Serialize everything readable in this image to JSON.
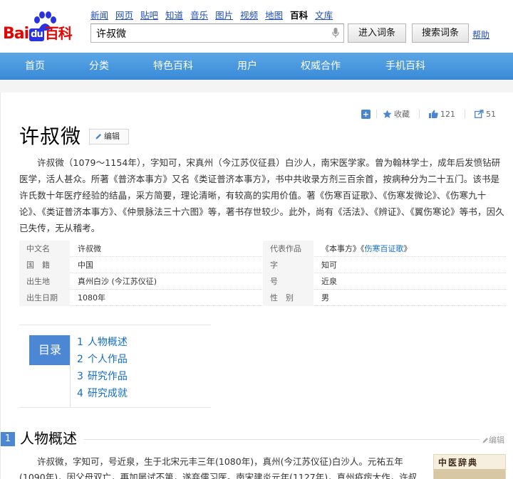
{
  "header": {
    "logo_text": "Bai du 百科",
    "logo_bai": "Bai",
    "logo_du": "du",
    "logo_baike": "百科",
    "top_nav": [
      "新闻",
      "网页",
      "贴吧",
      "知道",
      "音乐",
      "图片",
      "视频",
      "地图",
      "百科",
      "文库"
    ],
    "top_nav_current": "百科",
    "search_value": "许叔微",
    "enter_button": "进入词条",
    "search_button": "搜索词条",
    "help_link": "帮助"
  },
  "main_nav": [
    "首页",
    "分类",
    "特色百科",
    "用户",
    "权威合作",
    "手机百科"
  ],
  "toolbar": {
    "collect_label": "收藏",
    "like_count": "121",
    "share_count": "51"
  },
  "entry": {
    "title": "许叔微",
    "edit_label": "编辑",
    "summary": "许叔微（1079～1154年），字知可，宋真州（今江苏仪征县）白沙人，南宋医学家。曾为翰林学士，成年后发愤钻研医学，活人甚众。所著《普济本事方》又名《类证普济本事方》，书中共收录方剂三百余首，按病种分为二十五门。该书是许氏数十年医疗经验的结晶，采方简要，理论清晰，有较高的实用价值。著《伤寒百证歌》、《伤寒发微论》、《伤寒九十论》、《类证普济本事方》、《仲景脉法三十六图》等，著书存世较少。此外，尚有《活法》、《辨证》、《翼伤寒论》等书，因久已失传，无从稽考。"
  },
  "basic_info": {
    "left": [
      {
        "key": "中文名",
        "value": "许叔微"
      },
      {
        "key": "国　籍",
        "value": "中国"
      },
      {
        "key": "出生地",
        "value": "真州白沙 (今江苏仪征)"
      },
      {
        "key": "出生日期",
        "value": "1080年"
      }
    ],
    "right": [
      {
        "key": "代表作品",
        "value_prefix": "《本事方》《",
        "value_link": "伤寒百证歌",
        "value_suffix": "》"
      },
      {
        "key": "字",
        "value": "知可"
      },
      {
        "key": "号",
        "value": "近泉"
      },
      {
        "key": "性　别",
        "value": "男"
      }
    ]
  },
  "catalog": {
    "header": "目录",
    "items": [
      {
        "num": "1",
        "label": "人物概述"
      },
      {
        "num": "2",
        "label": "个人作品"
      },
      {
        "num": "3",
        "label": "研究作品"
      },
      {
        "num": "4",
        "label": "研究成就"
      }
    ]
  },
  "section1": {
    "num": "1",
    "title": "人物概述",
    "edit_label": "编辑",
    "text": "许叔微，字知可，号近泉，生于北宋元丰三年(1080年)，真州(今江苏仪征)白沙人。元祐五年(1090年)，因父母双亡，再加屡试不第，遂弃儒习医。南宋建炎元年(1127年)，真州疫疠大作，许叔微上门为百"
  },
  "thumbnail": {
    "text": "中医辞典"
  },
  "colors": {
    "nav_blue": "#3a8bd8",
    "link_blue": "#136ec2",
    "accent_blue": "#4b87d4",
    "baidu_red": "#e10601"
  }
}
